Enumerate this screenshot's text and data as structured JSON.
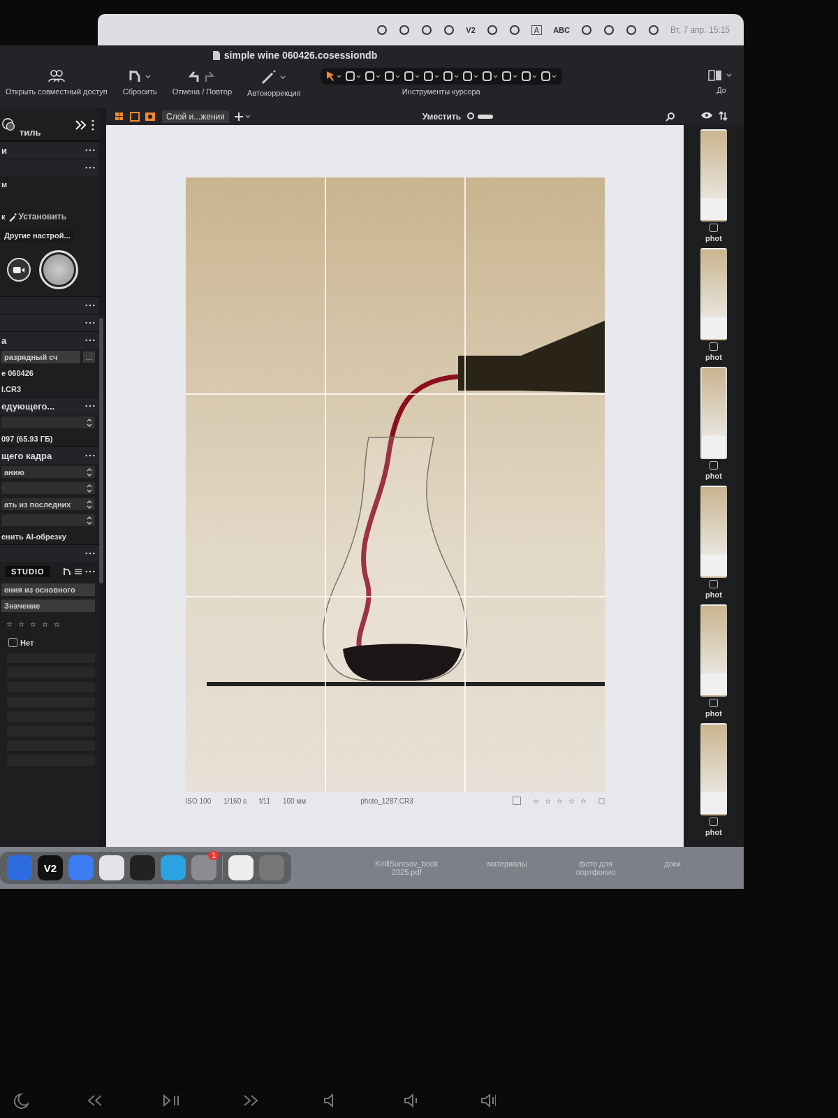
{
  "menu_bar": {
    "status_items": [
      {
        "kind": "icon"
      },
      {
        "kind": "icon"
      },
      {
        "kind": "icon"
      },
      {
        "kind": "icon"
      },
      {
        "kind": "text",
        "text": "V2"
      },
      {
        "kind": "icon"
      },
      {
        "kind": "icon"
      },
      {
        "kind": "boxed",
        "text": "A"
      },
      {
        "kind": "text",
        "text": "ABC"
      },
      {
        "kind": "icon"
      },
      {
        "kind": "icon"
      },
      {
        "kind": "icon"
      },
      {
        "kind": "icon"
      }
    ],
    "clock": "Вт, 7 апр.  15:15"
  },
  "window": {
    "title": "simple wine 060426.cosessiondb"
  },
  "toolbar": {
    "buttons": [
      {
        "kind": "share",
        "label": "Открыть совместный доступ"
      },
      {
        "kind": "reset",
        "label": "Сбросить"
      },
      {
        "kind": "undo",
        "label": "Отмена / Повтор"
      },
      {
        "kind": "auto",
        "label": "Автокоррекция"
      }
    ],
    "cursor_tools": [
      {
        "selected": true
      },
      {
        "selected": false
      },
      {
        "selected": false
      },
      {
        "selected": false
      },
      {
        "selected": false
      },
      {
        "selected": false
      },
      {
        "selected": false
      },
      {
        "selected": false
      },
      {
        "selected": false
      },
      {
        "selected": false
      },
      {
        "selected": false
      },
      {
        "selected": false
      }
    ],
    "cursor_tools_label": "Инструменты курсора",
    "before_label": "До"
  },
  "viewer_bar": {
    "layer_select": "Слой и...жения",
    "fit_label": "Уместить"
  },
  "left_panel": {
    "rows": [
      {
        "kind": "tool",
        "text": "тиль"
      },
      {
        "kind": "header",
        "text": "и"
      },
      {
        "kind": "header"
      },
      {
        "kind": "text",
        "text": "м"
      },
      {
        "kind": "set",
        "text": "к",
        "button": "Установить"
      },
      {
        "kind": "button",
        "text": "Другие настрой..."
      },
      {
        "kind": "capture"
      },
      {
        "kind": "header"
      },
      {
        "kind": "header"
      },
      {
        "kind": "header",
        "text": "а"
      },
      {
        "kind": "field",
        "text": "разрядный сч",
        "extra": "..."
      },
      {
        "kind": "text",
        "text": "е 060426"
      },
      {
        "kind": "text",
        "text": "I.CR3"
      },
      {
        "kind": "header",
        "text": "едующего..."
      },
      {
        "kind": "select"
      },
      {
        "kind": "text",
        "text": "097 (65.93 ГБ)"
      },
      {
        "kind": "header",
        "text": "щего кадра"
      },
      {
        "kind": "select",
        "text": "анию"
      },
      {
        "kind": "select"
      },
      {
        "kind": "select",
        "text": "ать из последних"
      },
      {
        "kind": "select"
      },
      {
        "kind": "text",
        "text": "енить AI-обрезку"
      },
      {
        "kind": "header"
      },
      {
        "kind": "studio",
        "text": "STUDIO"
      },
      {
        "kind": "field",
        "text": "ения из основного"
      },
      {
        "kind": "field",
        "text": "Значение"
      },
      {
        "kind": "stars",
        "stars": 0
      },
      {
        "kind": "checkbox",
        "text": "Нет",
        "checked": false
      },
      {
        "kind": "bar"
      },
      {
        "kind": "bar"
      },
      {
        "kind": "bar"
      },
      {
        "kind": "bar"
      },
      {
        "kind": "bar"
      },
      {
        "kind": "bar"
      },
      {
        "kind": "bar"
      },
      {
        "kind": "bar"
      }
    ]
  },
  "viewer": {
    "photo_info": [
      "ISO 100",
      "1/160 s",
      "f/11",
      "100 мм"
    ],
    "filename": "photo_1287.CR3",
    "checked": false,
    "stars": 0
  },
  "filmstrip": [
    {
      "label": "phot",
      "selected": false,
      "checked": false
    },
    {
      "label": "phot",
      "selected": false,
      "checked": false
    },
    {
      "label": "phot",
      "selected": true,
      "checked": false
    },
    {
      "label": "phot",
      "selected": false,
      "checked": false
    },
    {
      "label": "phot",
      "selected": false,
      "checked": false
    },
    {
      "label": "phot",
      "selected": false,
      "checked": false
    }
  ],
  "dock": {
    "apps": [
      {
        "kind": "blue"
      },
      {
        "kind": "v2",
        "text": "V2"
      },
      {
        "kind": "wave"
      },
      {
        "kind": "ring"
      },
      {
        "kind": "sun"
      },
      {
        "kind": "telegram"
      },
      {
        "kind": "settings",
        "badge": "1"
      },
      {
        "kind": "divider"
      },
      {
        "kind": "doc"
      },
      {
        "kind": "trash"
      }
    ]
  },
  "desktop_items": [
    "KirillSuntsov_book\n2025.pdf",
    "материалы",
    "фото для\nпортфолио",
    "доки"
  ]
}
